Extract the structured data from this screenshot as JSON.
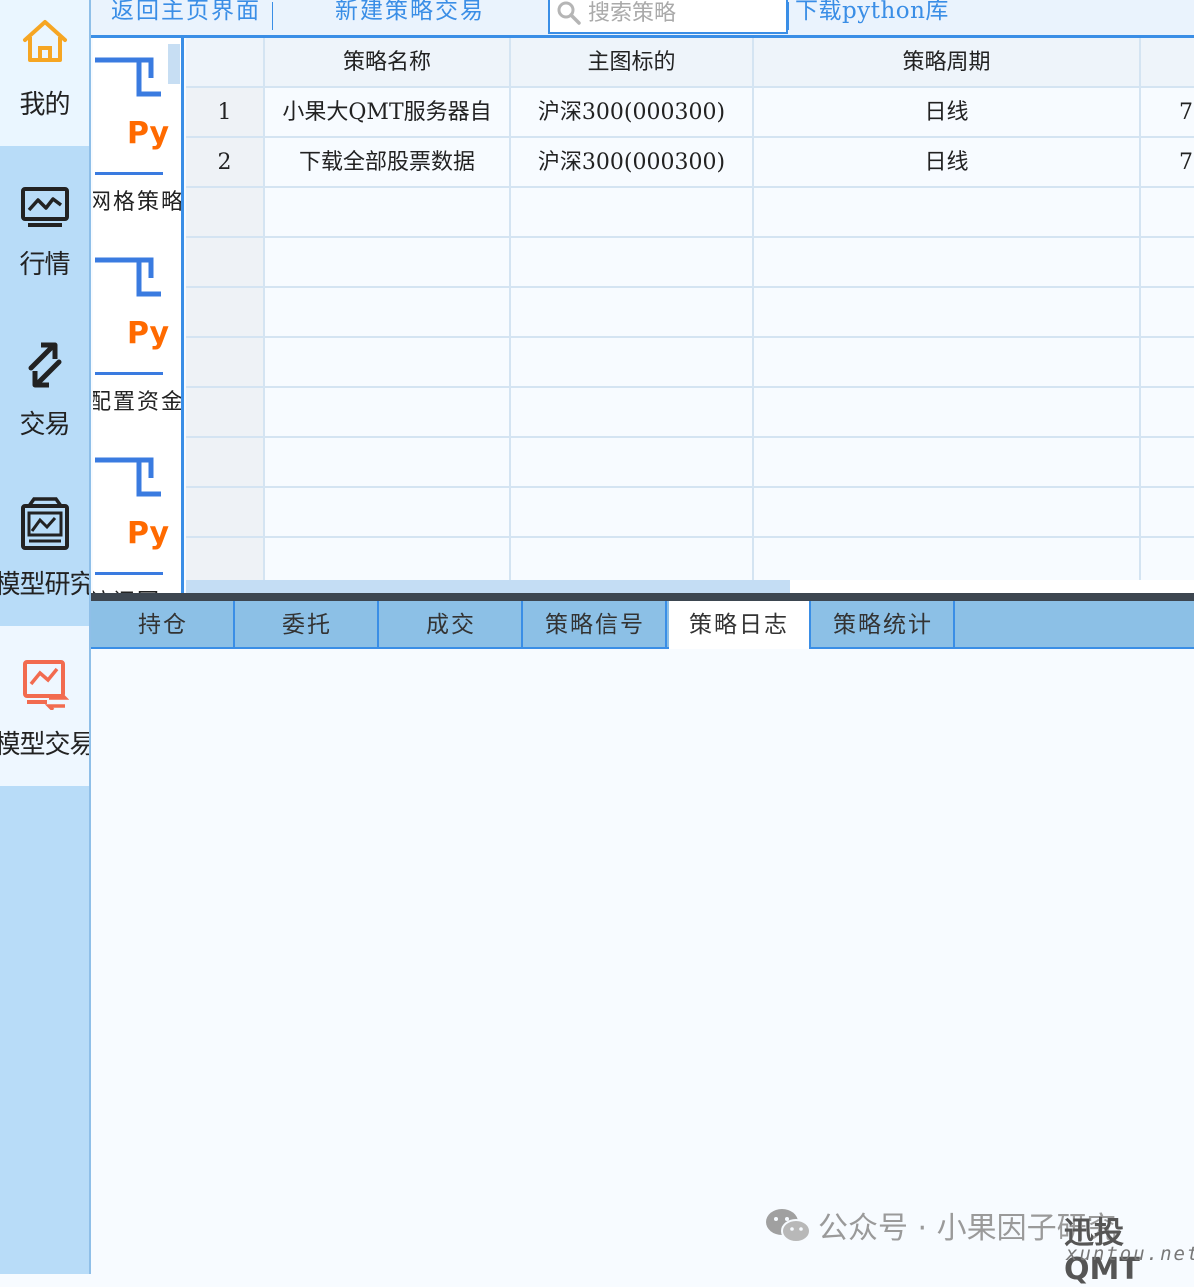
{
  "sidebar": {
    "items": [
      {
        "label": "我的",
        "icon": "home-icon"
      },
      {
        "label": "行情",
        "icon": "chart-monitor-icon"
      },
      {
        "label": "交易",
        "icon": "exchange-arrows-icon"
      },
      {
        "label": "模型研究",
        "icon": "model-research-icon"
      },
      {
        "label": "模型交易",
        "icon": "model-trade-icon"
      }
    ]
  },
  "toolbar": {
    "back_label": "返回主页界面",
    "new_label": "新建策略交易",
    "search_placeholder": "搜索策略",
    "download_label": "下载python库"
  },
  "strategy_list": {
    "cards": [
      {
        "badge": "Py",
        "name": "网格策略"
      },
      {
        "badge": "Py",
        "name": "配置资金"
      },
      {
        "badge": "Py",
        "name": "访问回"
      }
    ]
  },
  "table": {
    "columns": [
      "",
      "策略名称",
      "主图标的",
      "策略周期",
      ""
    ],
    "rows": [
      {
        "index": "1",
        "name": "小果大QMT服务器自",
        "symbol": "沪深300(000300)",
        "period": "日线",
        "extra": "7"
      },
      {
        "index": "2",
        "name": "下载全部股票数据",
        "symbol": "沪深300(000300)",
        "period": "日线",
        "extra": "7"
      }
    ]
  },
  "bottom_tabs": {
    "items": [
      "持仓",
      "委托",
      "成交",
      "策略信号",
      "策略日志",
      "策略统计"
    ],
    "active": "策略日志"
  },
  "watermark": {
    "text": "公众号 · 小果因子研究",
    "brand": "迅投QMT",
    "site": "xuntou.net"
  },
  "colors": {
    "accent": "#3a8ee6",
    "sidebar_bg": "#b8dcf8",
    "py_orange": "#ff6a00",
    "icon_orange": "#f6a623",
    "icon_coral": "#f26b4f"
  }
}
